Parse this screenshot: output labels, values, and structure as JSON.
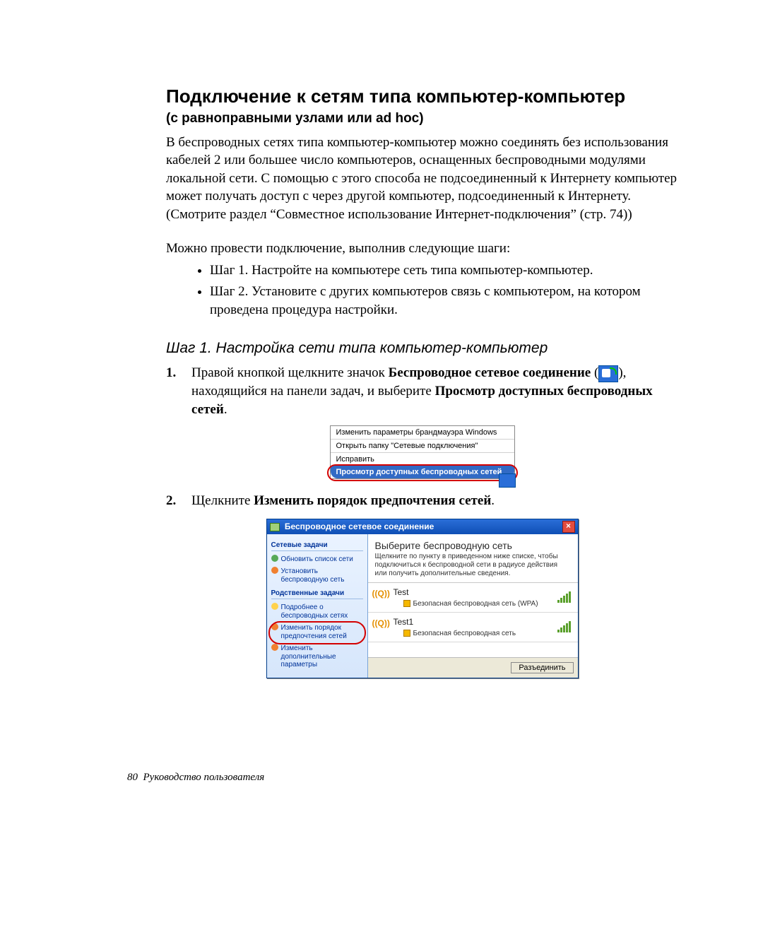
{
  "title": "Подключение к сетям типа компьютер-компьютер",
  "subtitle": "(с равноправными узлами или ad hoc)",
  "para1": "В беспроводных сетях типа компьютер-компьютер можно соединять без использования кабелей 2 или большее число компьютеров, оснащенных беспроводными модулями локальной сети. С помощью с этого способа не подсоединенный к Интернету компьютер может получать доступ с через другой компьютер, подсоединенный к Интернету. (Смотрите раздел “Совместное использование Интернет-подключения” (стр. 74))",
  "para2": "Можно провести подключение, выполнив следующие шаги:",
  "bullets": [
    "Шаг 1. Настройте на компьютере сеть типа компьютер-компьютер.",
    "Шаг 2. Установите с других компьютеров связь с компьютером, на котором проведена процедура настройки."
  ],
  "step1_heading": "Шаг 1. Настройка сети типа компьютер-компьютер",
  "step1_item1_prefix": "Правой кнопкой щелкните значок ",
  "step1_item1_bold1": "Беспроводное сетевое соединение",
  "step1_item1_mid": ", находящийся на панели задач, и выберите ",
  "step1_item1_bold2": "Просмотр доступных беспроводных сетей",
  "step1_item1_suffix": ".",
  "context_menu": {
    "items": [
      "Изменить параметры брандмауэра Windows",
      "Открыть папку \"Сетевые подключения\"",
      "Исправить"
    ],
    "selected": "Просмотр доступных беспроводных сетей"
  },
  "step1_item2_prefix": "Щелкните ",
  "step1_item2_bold": "Изменить порядок предпочтения сетей",
  "step1_item2_suffix": ".",
  "dialog": {
    "title": "Беспроводное сетевое соединение",
    "sidebar_group1": "Сетевые задачи",
    "sidebar_links1": [
      "Обновить список сети",
      "Установить беспроводную сеть"
    ],
    "sidebar_group2": "Родственные задачи",
    "sidebar_links2": [
      "Подробнее о беспроводных сетях",
      "Изменить порядок предпочтения сетей",
      "Изменить дополнительные параметры"
    ],
    "main_header": "Выберите беспроводную сеть",
    "main_desc": "Щелкните по пункту в приведенном ниже списке, чтобы подключиться к беспроводной сети в радиусе действия или получить дополнительные сведения.",
    "networks": [
      {
        "name": "Test",
        "security": "Безопасная беспроводная сеть (WPA)"
      },
      {
        "name": "Test1",
        "security": "Безопасная беспроводная сеть"
      }
    ],
    "button": "Разъединить",
    "antenna_label": "((Q))"
  },
  "footer_page": "80",
  "footer_text": "Руководство пользователя"
}
